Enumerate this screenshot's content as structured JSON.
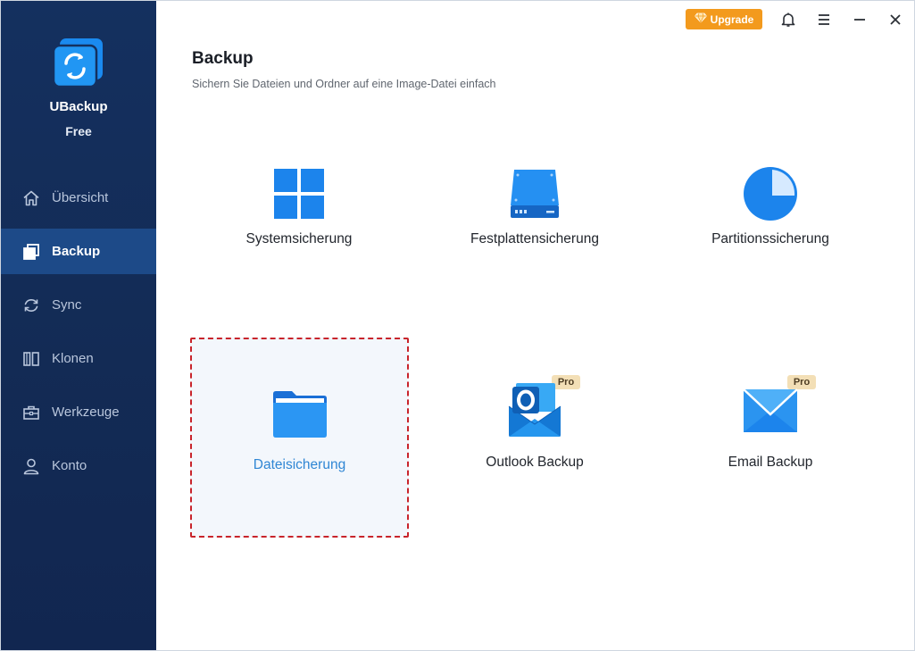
{
  "app": {
    "name": "UBackup",
    "edition": "Free"
  },
  "sidebar": {
    "items": [
      {
        "label": "Übersicht",
        "icon": "home-icon",
        "active": false
      },
      {
        "label": "Backup",
        "icon": "backup-icon",
        "active": true
      },
      {
        "label": "Sync",
        "icon": "sync-icon",
        "active": false
      },
      {
        "label": "Klonen",
        "icon": "clone-icon",
        "active": false
      },
      {
        "label": "Werkzeuge",
        "icon": "toolbox-icon",
        "active": false
      },
      {
        "label": "Konto",
        "icon": "user-icon",
        "active": false
      }
    ]
  },
  "titlebar": {
    "upgrade_label": "Upgrade",
    "icons": [
      "bell-icon",
      "menu-icon",
      "minimize-icon",
      "close-icon"
    ]
  },
  "page": {
    "title": "Backup",
    "subtitle": "Sichern Sie Dateien und Ordner auf eine Image-Datei einfach"
  },
  "cards": [
    {
      "label": "Systemsicherung",
      "icon": "windows-icon",
      "pro": false,
      "selected": false
    },
    {
      "label": "Festplattensicherung",
      "icon": "hard-disk-icon",
      "pro": false,
      "selected": false
    },
    {
      "label": "Partitionssicherung",
      "icon": "pie-partition-icon",
      "pro": false,
      "selected": false
    },
    {
      "label": "Dateisicherung",
      "icon": "folder-icon",
      "pro": false,
      "selected": true
    },
    {
      "label": "Outlook Backup",
      "icon": "outlook-icon",
      "pro": true,
      "pro_label": "Pro",
      "selected": false
    },
    {
      "label": "Email Backup",
      "icon": "envelope-icon",
      "pro": true,
      "pro_label": "Pro",
      "selected": false
    }
  ],
  "colors": {
    "sidebar_bg": "#14305f",
    "sidebar_active": "#1d4a88",
    "accent_blue": "#1e88e5",
    "upgrade_orange": "#f39a1d",
    "selection_border": "#c8242b",
    "selected_label": "#2f86d4",
    "pro_badge_bg": "#f3dfb6"
  }
}
